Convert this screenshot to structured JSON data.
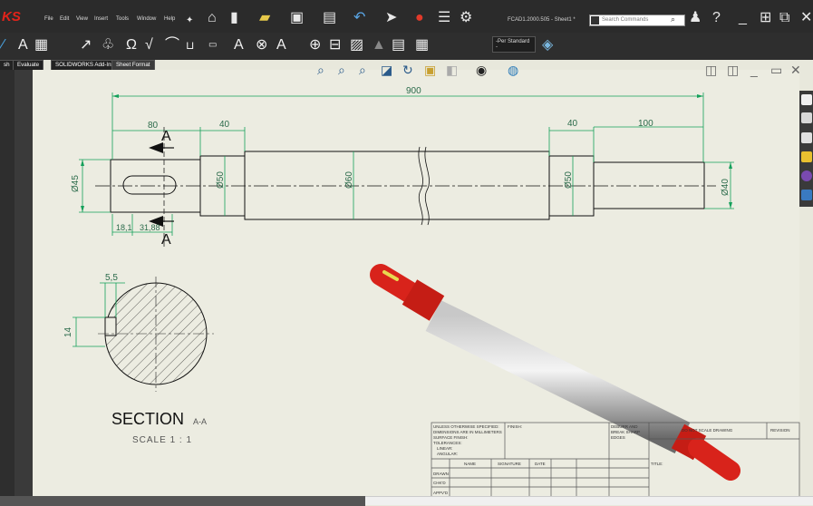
{
  "app": {
    "logo": "KS",
    "doc_title": "FCAD1.2000.505 - Sheet1 *"
  },
  "menu": [
    "File",
    "Edit",
    "View",
    "Insert",
    "Tools",
    "Window",
    "Help"
  ],
  "search": {
    "placeholder": "Search Commands"
  },
  "toolbar": {
    "standard_select": "-Per Standard -"
  },
  "tabs": [
    "sh",
    "Evaluate",
    "SOLIDWORKS Add-Ins",
    "Sheet Format"
  ],
  "drawing": {
    "dims": {
      "overall_length": "900",
      "left_80": "80",
      "left_40": "40",
      "right_40": "40",
      "right_100": "100",
      "d45": "Ø45",
      "d50a": "Ø50",
      "d60": "Ø60",
      "d50b": "Ø50",
      "d40": "Ø40",
      "key_18_1": "18,1",
      "key_31_88": "31,88"
    },
    "section_arrow_label": "A",
    "section": {
      "dim_5_5": "5,5",
      "dim_14": "14",
      "title": "SECTION",
      "title_suffix": "A-A",
      "scale": "SCALE 1 : 1"
    },
    "title_block": {
      "notes": [
        "UNLESS OTHERWISE SPECIFIED:",
        "DIMENSIONS ARE IN MILLIMETERS",
        "SURFACE FINISH:",
        "TOLERANCES:",
        "LINEAR:",
        "ANGULAR:"
      ],
      "finish": "FINISH:",
      "deburr": [
        "DEBURR AND",
        "BREAK SHARP",
        "EDGES"
      ],
      "do_not_scale": "DO NOT SCALE DRAWING",
      "revision": "REVISION",
      "name": "NAME",
      "signature": "SIGNATURE",
      "date": "DATE",
      "title": "TITLE:",
      "rows": [
        "DRAWN",
        "CHK'D",
        "APPV'D"
      ]
    }
  },
  "colors": {
    "model_red": "#d8231b",
    "model_grey": "#9a9a9a"
  }
}
